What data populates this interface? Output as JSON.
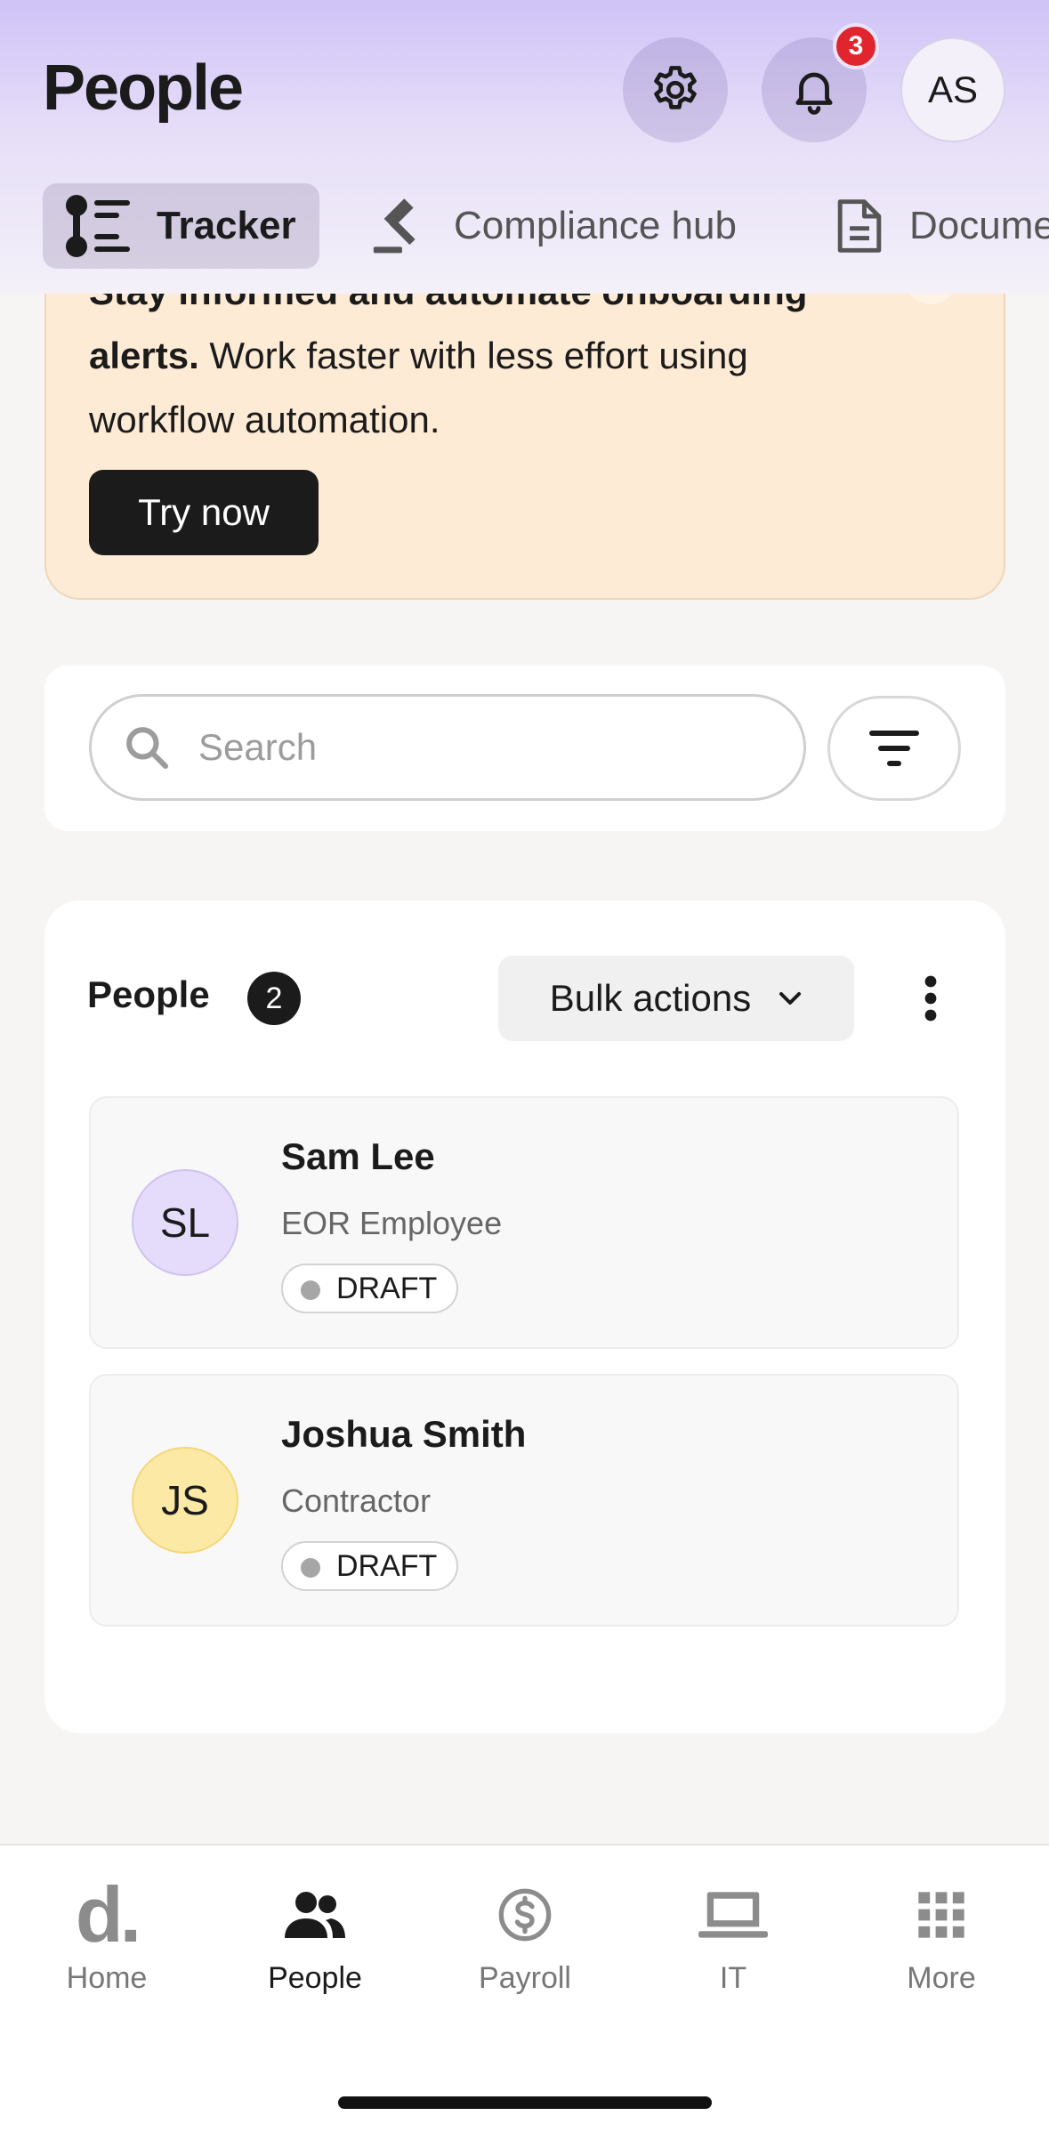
{
  "header": {
    "title": "People",
    "notifications_count": "3",
    "avatar_initials": "AS"
  },
  "tabs": [
    {
      "label": "Tracker",
      "icon": "tracker-icon",
      "active": true
    },
    {
      "label": "Compliance hub",
      "icon": "gavel-icon",
      "active": false
    },
    {
      "label": "Docume",
      "icon": "document-icon",
      "active": false
    }
  ],
  "banner": {
    "bold_line_1": "Stay informed and automate onboarding",
    "bold_line_2": "alerts.",
    "body": " Work faster with less effort using workflow automation.",
    "cta_label": "Try now"
  },
  "search": {
    "placeholder": "Search",
    "value": ""
  },
  "people_card": {
    "title": "People",
    "count": "2",
    "bulk_actions_label": "Bulk actions",
    "people": [
      {
        "initials": "SL",
        "name": "Sam Lee",
        "role": "EOR Employee",
        "status": "DRAFT",
        "avatar_color": "#e4dcfa",
        "avatar_border": "#cfc2f2"
      },
      {
        "initials": "JS",
        "name": "Joshua Smith",
        "role": "Contractor",
        "status": "DRAFT",
        "avatar_color": "#fce9a6",
        "avatar_border": "#f3d77a"
      }
    ]
  },
  "bottom_nav": [
    {
      "label": "Home",
      "icon": "home-logo-icon",
      "glyph": "d.",
      "active": false
    },
    {
      "label": "People",
      "icon": "people-icon",
      "active": true
    },
    {
      "label": "Payroll",
      "icon": "dollar-circle-icon",
      "active": false
    },
    {
      "label": "IT",
      "icon": "laptop-icon",
      "active": false
    },
    {
      "label": "More",
      "icon": "grid-icon",
      "active": false
    }
  ],
  "colors": {
    "accent_dark": "#1b1b1b",
    "badge_red": "#e1252f",
    "banner_bg": "#fdebd5",
    "header_gradient_top": "#cfc3f7"
  }
}
